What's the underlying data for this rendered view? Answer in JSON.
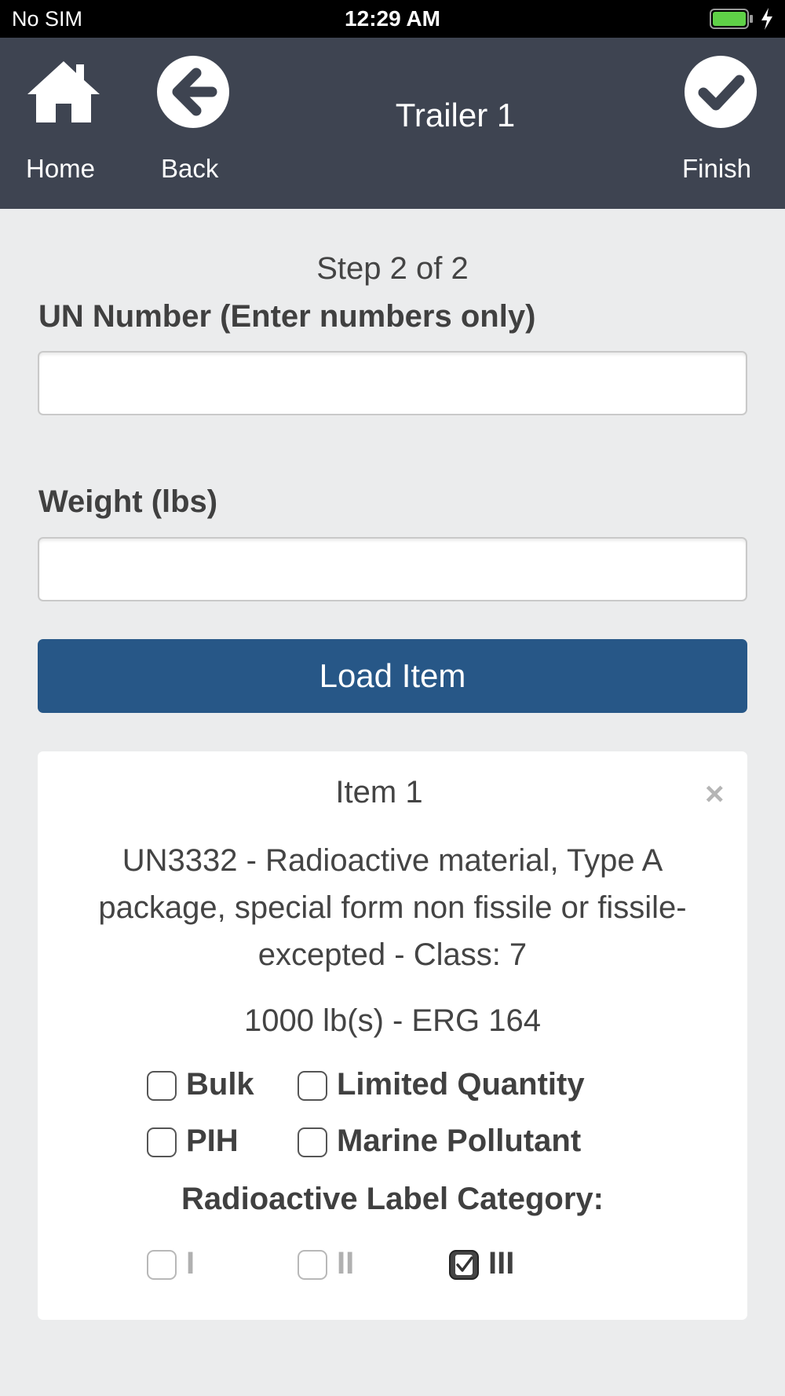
{
  "status_bar": {
    "carrier": "No SIM",
    "time": "12:29 AM"
  },
  "header": {
    "home_label": "Home",
    "back_label": "Back",
    "title": "Trailer 1",
    "finish_label": "Finish",
    "background": "#3e4451"
  },
  "form": {
    "step_text": "Step 2 of 2",
    "un_label": "UN Number (Enter numbers only)",
    "un_value": "",
    "weight_label": "Weight (lbs)",
    "weight_value": "",
    "load_button": "Load Item",
    "load_button_color": "#275787"
  },
  "item": {
    "title": "Item 1",
    "close": "×",
    "description": "UN3332 - Radioactive material, Type A package, special form non fissile or fissile-excepted - Class: 7",
    "weight_line": "1000 lb(s) - ERG 164",
    "options": [
      {
        "label": "Bulk",
        "checked": false
      },
      {
        "label": "Limited Quantity",
        "checked": false
      },
      {
        "label": "PIH",
        "checked": false
      },
      {
        "label": "Marine Pollutant",
        "checked": false
      }
    ],
    "radioactive_title": "Radioactive Label Category:",
    "categories": [
      {
        "label": "I",
        "checked": false
      },
      {
        "label": "II",
        "checked": false
      },
      {
        "label": "III",
        "checked": true
      }
    ]
  }
}
